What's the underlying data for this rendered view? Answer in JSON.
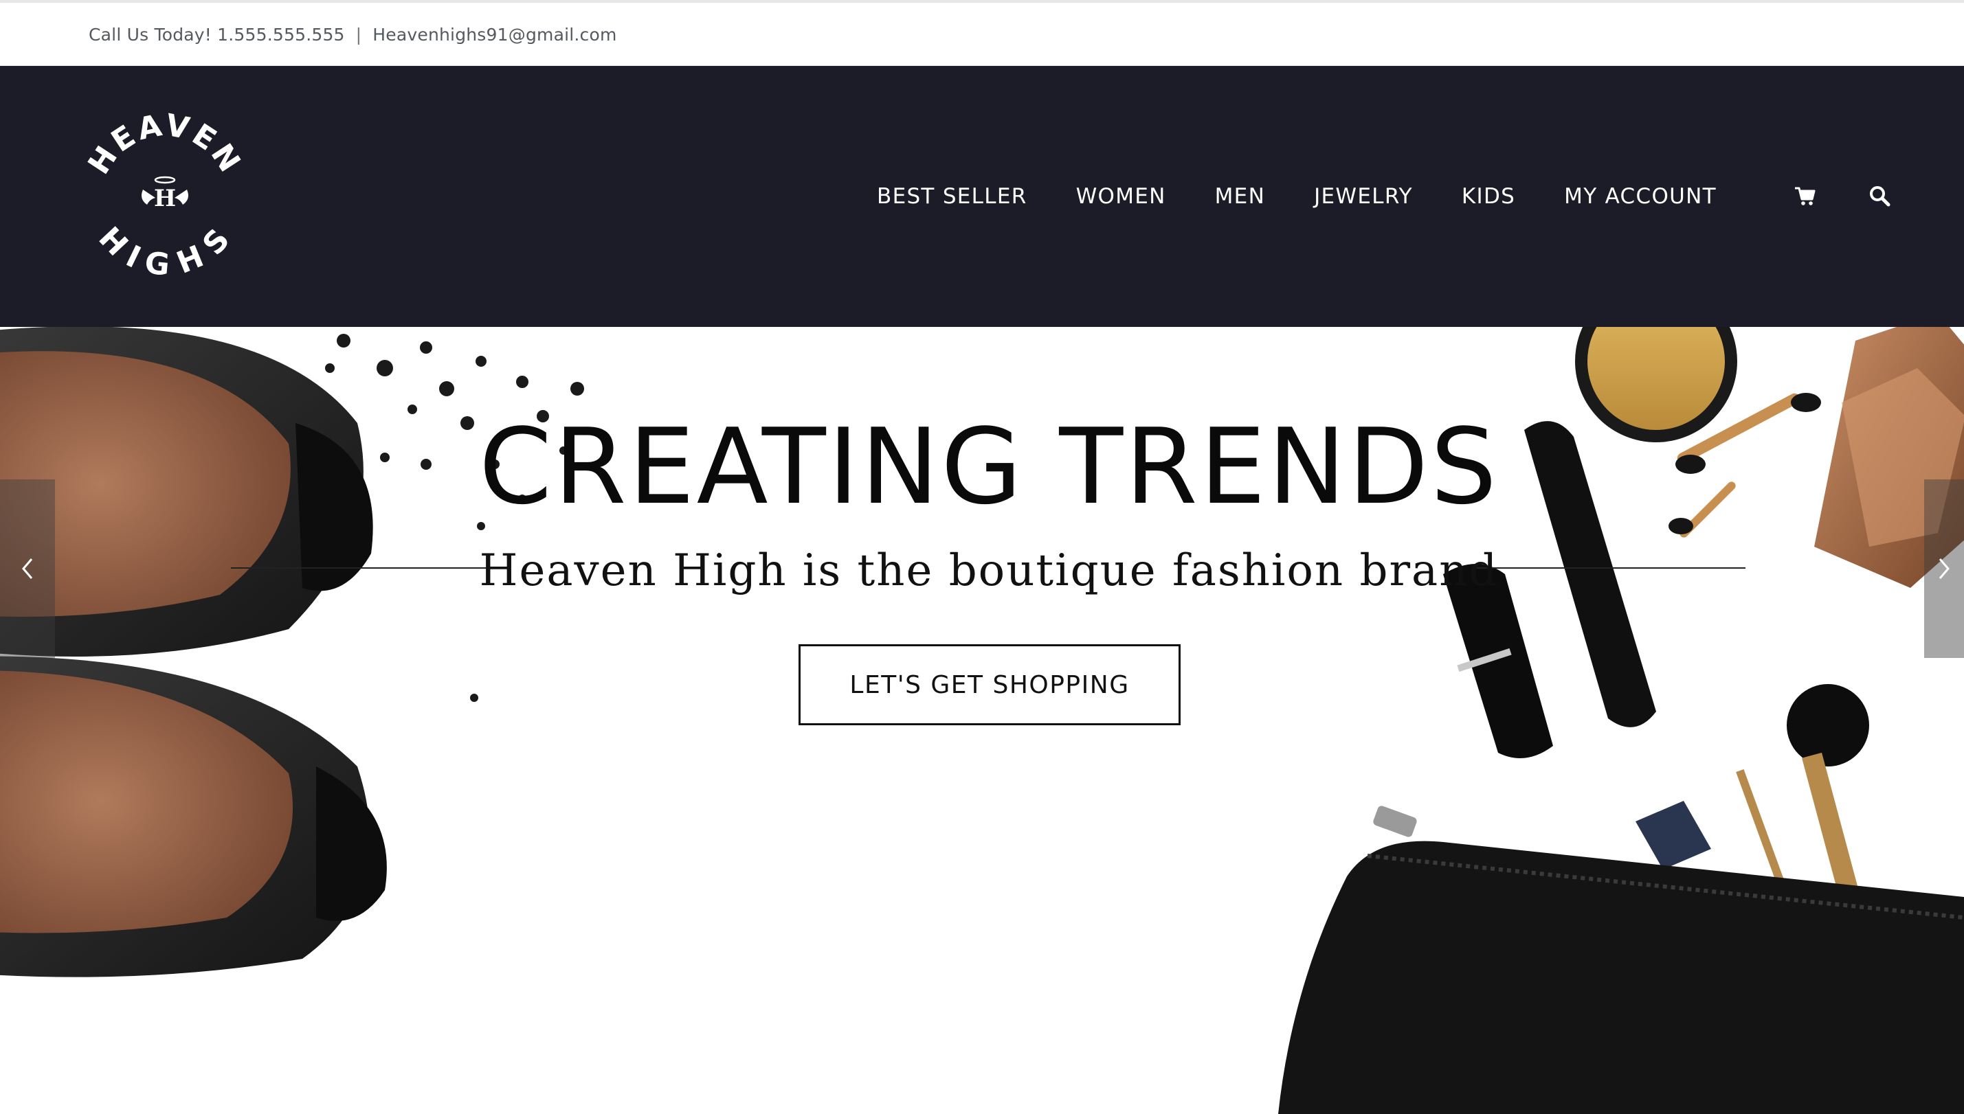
{
  "topbar": {
    "phone": "Call Us Today! 1.555.555.555",
    "separator": "|",
    "email": "Heavenhighs91@gmail.com"
  },
  "logo": {
    "top_text": "HEAVEN",
    "bottom_text": "HIGHS",
    "monogram": "H"
  },
  "nav": {
    "items": [
      {
        "label": "BEST SELLER"
      },
      {
        "label": "WOMEN"
      },
      {
        "label": "MEN"
      },
      {
        "label": "JEWELRY"
      },
      {
        "label": "KIDS"
      },
      {
        "label": "MY ACCOUNT"
      }
    ],
    "cart_icon": "cart-icon",
    "search_icon": "search-icon"
  },
  "hero": {
    "title": "CREATING TRENDS",
    "subtitle": "Heaven High is the boutique fashion brand",
    "cta_label": "LET'S GET SHOPPING",
    "prev_icon": "chevron-left-icon",
    "next_icon": "chevron-right-icon"
  },
  "colors": {
    "header_bg": "#1b1c27",
    "nav_text": "#ffffff",
    "hero_bg": "#ffffff",
    "text_dark": "#111111"
  }
}
